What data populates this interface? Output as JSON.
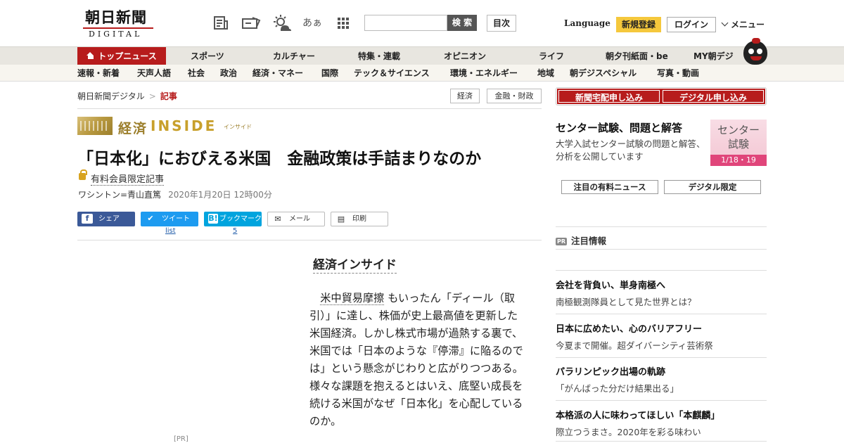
{
  "header": {
    "logo_kanji": "朝日新聞",
    "logo_sub": "DIGITAL",
    "icons": [
      "newspaper-icon",
      "coupon-icon",
      "weather-icon",
      "font-size-icon",
      "apps-grid-icon"
    ],
    "font_icon_text": "あぁ",
    "search_placeholder": "",
    "search_button": "検 索",
    "index_button": "目次",
    "language": "Language",
    "register": "新規登録",
    "login": "ログイン",
    "menu": "メニュー"
  },
  "nav_main": [
    "トップニュース",
    "スポーツ",
    "カルチャー",
    "特集・連載",
    "オピニオン",
    "ライフ",
    "朝夕刊紙面・be",
    "MY朝デジ"
  ],
  "nav_sub": [
    "速報・新着",
    "天声人語",
    "社会",
    "政治",
    "経済・マネー",
    "国際",
    "テック＆サイエンス",
    "環境・エネルギー",
    "地域",
    "朝デジスペシャル",
    "写真・動画"
  ],
  "breadcrumb": {
    "home": "朝日新聞デジタル",
    "sep": ">",
    "current": "記事"
  },
  "tags": [
    "経済",
    "金融・財政"
  ],
  "article": {
    "kicker_1": "経済",
    "kicker_2": "INSIDE",
    "kicker_ruby": "インサイド",
    "title": "「日本化」におびえる米国　金融政策は手詰まりなのか",
    "paid_label": "有料会員限定記事",
    "byline": "ワシントン=青山直篤",
    "date": "2020年1月20日 12時00分",
    "section_heading": "経済インサイド",
    "body_link": "米中貿易摩擦",
    "body_rest": "もいったん「ディール（取引）」に達し、株価が史上最高値を更新した米国経済。しかし株式市場が過熱する裏で、米国では「日本のような『停滞』に陥るのでは」という懸念がじわりと広がりつつある。様々な課題を抱えるとはいえ、底堅い成長を続ける米国がなぜ「日本化」を心配しているのか。",
    "pr_label": "[PR]"
  },
  "share": {
    "facebook": "シェア",
    "twitter": "ツイート",
    "hatena": "ブックマーク",
    "mail": "メール",
    "print": "印刷",
    "twitter_count": "list",
    "hatena_count": "5"
  },
  "sidebar": {
    "newspaper_button": "新聞宅配申し込み",
    "digital_button": "デジタル申し込み",
    "center_title": "センター試験、問題と解答",
    "center_desc": "大学入試センター試験の問題と解答、分析を公開しています",
    "banner_line1": "センター",
    "banner_line2": "試験",
    "banner_date": "1/18・19",
    "tab_paid": "注目の有料ニュース",
    "tab_digital": "デジタル限定",
    "pr_badge": "PR",
    "pr_heading": "注目情報",
    "pr_items": [
      {
        "title": "会社を背負い、単身南極へ",
        "sub": "南極観測隊員として見た世界とは？"
      },
      {
        "title": "日本に広めたい、心のバリアフリー",
        "sub": "今夏まで開催。超ダイバーシティ芸術祭"
      },
      {
        "title": "パラリンピック出場の軌跡",
        "sub": "「がんばった分だけ結果出る」"
      },
      {
        "title": "本格派の人に味わってほしい「本麒麟」",
        "sub": "際立つうまさ。2020年を彩る味わい"
      }
    ]
  },
  "colors": {
    "brand_red": "#b71c1c",
    "accent_gold": "#c8a02c",
    "register_yellow": "#f5c83c",
    "facebook": "#3b5998",
    "twitter": "#1d9bf0",
    "hatena": "#00a4de"
  }
}
